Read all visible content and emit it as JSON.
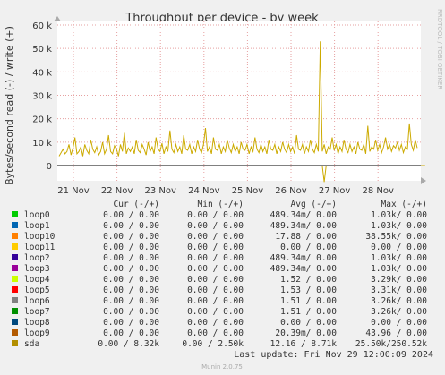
{
  "chart_data": {
    "type": "line",
    "title": "Throughput per device - by week",
    "ylabel": "Bytes/second read (-) / write (+)",
    "ylim": [
      -8000,
      60000
    ],
    "yticks": [
      {
        "v": 0,
        "label": "0"
      },
      {
        "v": 10000,
        "label": "10 k"
      },
      {
        "v": 20000,
        "label": "20 k"
      },
      {
        "v": 30000,
        "label": "30 k"
      },
      {
        "v": 40000,
        "label": "40 k"
      },
      {
        "v": 50000,
        "label": "50 k"
      },
      {
        "v": 60000,
        "label": "60 k"
      }
    ],
    "xticks": [
      "21 Nov",
      "22 Nov",
      "23 Nov",
      "24 Nov",
      "25 Nov",
      "26 Nov",
      "27 Nov",
      "28 Nov"
    ],
    "grid": true,
    "side_label": "RRDTOOL / TOBI OETIKER",
    "series_color": "#ccaa00",
    "zero_color": "#000000",
    "series": [
      {
        "name": "sda",
        "write": [
          4000,
          5500,
          7000,
          5000,
          6000,
          9000,
          4500,
          7500,
          12000,
          5000,
          6000,
          8000,
          4000,
          9000,
          6500,
          5000,
          11000,
          7000,
          5500,
          8000,
          4500,
          6000,
          10000,
          5000,
          7000,
          13000,
          6000,
          5000,
          8500,
          7000,
          4000,
          9000,
          6000,
          14000,
          5000,
          7500,
          6000,
          8000,
          5000,
          11000,
          6500,
          5500,
          9000,
          7000,
          4500,
          10000,
          6000,
          8000,
          5000,
          12000,
          7000,
          6000,
          9500,
          5000,
          8000,
          6000,
          15000,
          7000,
          5500,
          9000,
          6000,
          8000,
          5000,
          13000,
          7000,
          6500,
          9000,
          5000,
          8000,
          6000,
          11000,
          7000,
          5500,
          9000,
          16000,
          6000,
          8000,
          5000,
          12000,
          7000,
          6500,
          9000,
          5000,
          8000,
          6000,
          11000,
          7500,
          5500,
          9000,
          6000,
          8000,
          5000,
          10000,
          7000,
          6500,
          9000,
          5000,
          8000,
          6000,
          12000,
          7000,
          5500,
          9000,
          6000,
          8000,
          5000,
          11000,
          7000,
          6500,
          9000,
          5000,
          8000,
          6000,
          10000,
          7000,
          5500,
          9000,
          6000,
          8000,
          5000,
          13000,
          7000,
          6500,
          9000,
          5000,
          8000,
          6000,
          11000,
          7000,
          5500,
          9000,
          6000,
          53000,
          6000,
          9000,
          5000,
          8000,
          7000,
          12000,
          6500,
          9000,
          5000,
          8000,
          6000,
          11000,
          7000,
          5500,
          9000,
          6000,
          8000,
          5000,
          10000,
          7000,
          6500,
          9000,
          5000,
          17000,
          6000,
          8000,
          7000,
          11000,
          6500,
          9000,
          5500,
          8000,
          12000,
          7000,
          9000,
          6000,
          8500,
          7500,
          10000,
          6500,
          9000,
          5500,
          8000,
          7000,
          18000,
          9000,
          6500,
          11000,
          7500
        ],
        "read": [
          0,
          0,
          0,
          0,
          0,
          0,
          0,
          0,
          0,
          0,
          0,
          0,
          0,
          0,
          0,
          0,
          0,
          0,
          0,
          0,
          0,
          0,
          0,
          0,
          0,
          0,
          0,
          0,
          0,
          0,
          0,
          0,
          0,
          0,
          0,
          0,
          0,
          0,
          0,
          0,
          0,
          0,
          0,
          0,
          0,
          0,
          0,
          0,
          0,
          0,
          0,
          0,
          0,
          0,
          0,
          0,
          0,
          0,
          0,
          0,
          0,
          0,
          0,
          0,
          0,
          0,
          0,
          0,
          0,
          0,
          0,
          0,
          0,
          0,
          0,
          0,
          0,
          0,
          0,
          0,
          0,
          0,
          0,
          0,
          0,
          0,
          0,
          0,
          0,
          0,
          0,
          0,
          0,
          0,
          0,
          0,
          0,
          0,
          0,
          0,
          0,
          0,
          0,
          0,
          0,
          0,
          0,
          0,
          0,
          0,
          0,
          0,
          0,
          0,
          0,
          0,
          0,
          0,
          0,
          0,
          0,
          0,
          0,
          0,
          0,
          0,
          0,
          0,
          0,
          0,
          0,
          0,
          0,
          0,
          7000,
          0,
          0,
          0,
          0,
          0,
          0,
          0,
          0,
          0,
          0,
          0,
          0,
          0,
          0,
          0,
          0,
          0,
          0,
          0,
          0,
          0,
          0,
          0,
          0,
          0,
          0,
          0,
          0,
          0,
          0,
          0,
          0,
          0,
          0,
          0,
          0,
          0,
          0,
          0,
          0,
          0,
          0,
          0,
          0,
          0,
          0,
          0,
          0,
          0,
          0,
          0
        ]
      }
    ]
  },
  "legend": {
    "headers": {
      "cur": "Cur (-/+)",
      "min": "Min (-/+)",
      "avg": "Avg (-/+)",
      "max": "Max (-/+)"
    },
    "rows": [
      {
        "name": "loop0",
        "color": "#00cc00",
        "cur": "0.00 /  0.00",
        "min": "0.00 /  0.00",
        "avg": "489.34m/  0.00",
        "max": "1.03k/  0.00"
      },
      {
        "name": "loop1",
        "color": "#0066b3",
        "cur": "0.00 /  0.00",
        "min": "0.00 /  0.00",
        "avg": "489.34m/  0.00",
        "max": "1.03k/  0.00"
      },
      {
        "name": "loop10",
        "color": "#ff8000",
        "cur": "0.00 /  0.00",
        "min": "0.00 /  0.00",
        "avg": "17.88 /  0.00",
        "max": "38.55k/  0.00"
      },
      {
        "name": "loop11",
        "color": "#ffcc00",
        "cur": "0.00 /  0.00",
        "min": "0.00 /  0.00",
        "avg": "0.00 /  0.00",
        "max": "0.00 /  0.00"
      },
      {
        "name": "loop2",
        "color": "#330099",
        "cur": "0.00 /  0.00",
        "min": "0.00 /  0.00",
        "avg": "489.34m/  0.00",
        "max": "1.03k/  0.00"
      },
      {
        "name": "loop3",
        "color": "#990099",
        "cur": "0.00 /  0.00",
        "min": "0.00 /  0.00",
        "avg": "489.34m/  0.00",
        "max": "1.03k/  0.00"
      },
      {
        "name": "loop4",
        "color": "#ccff00",
        "cur": "0.00 /  0.00",
        "min": "0.00 /  0.00",
        "avg": "1.52 /  0.00",
        "max": "3.29k/  0.00"
      },
      {
        "name": "loop5",
        "color": "#ff0000",
        "cur": "0.00 /  0.00",
        "min": "0.00 /  0.00",
        "avg": "1.53 /  0.00",
        "max": "3.31k/  0.00"
      },
      {
        "name": "loop6",
        "color": "#808080",
        "cur": "0.00 /  0.00",
        "min": "0.00 /  0.00",
        "avg": "1.51 /  0.00",
        "max": "3.26k/  0.00"
      },
      {
        "name": "loop7",
        "color": "#008f00",
        "cur": "0.00 /  0.00",
        "min": "0.00 /  0.00",
        "avg": "1.51 /  0.00",
        "max": "3.26k/  0.00"
      },
      {
        "name": "loop8",
        "color": "#00487d",
        "cur": "0.00 /  0.00",
        "min": "0.00 /  0.00",
        "avg": "0.00 /  0.00",
        "max": "0.00 /  0.00"
      },
      {
        "name": "loop9",
        "color": "#b35a00",
        "cur": "0.00 /  0.00",
        "min": "0.00 /  0.00",
        "avg": "20.39m/  0.00",
        "max": "43.96 /  0.00"
      },
      {
        "name": "sda",
        "color": "#b38f00",
        "cur": "0.00 /  8.32k",
        "min": "0.00 /  2.50k",
        "avg": "12.16 /  8.71k",
        "max": "25.50k/250.52k"
      }
    ]
  },
  "last_update": "Last update: Fri Nov 29 12:00:09 2024",
  "footer": "Munin 2.0.75"
}
